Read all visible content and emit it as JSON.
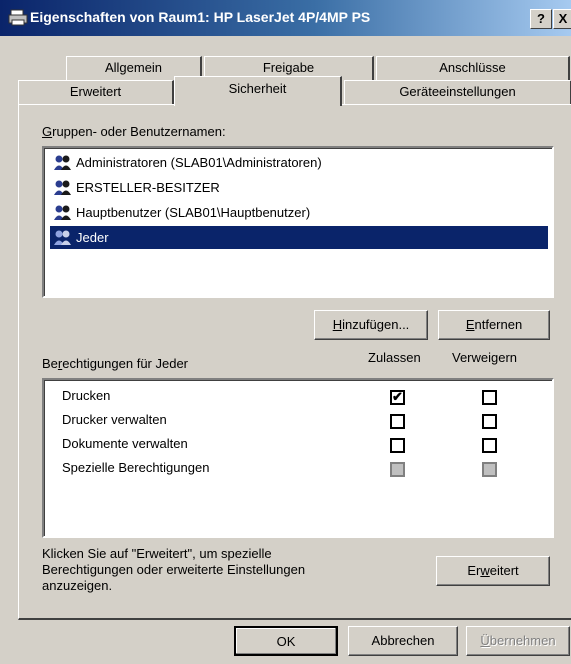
{
  "window": {
    "title": "Eigenschaften von Raum1: HP LaserJet 4P/4MP PS",
    "help_button": "?",
    "close_button": "X"
  },
  "tabs": {
    "row1": [
      "Allgemein",
      "Freigabe",
      "Anschlüsse"
    ],
    "row2": [
      "Erweitert",
      "Sicherheit",
      "Geräteeinstellungen"
    ],
    "active": "Sicherheit"
  },
  "groups": {
    "label_prefix": "G",
    "label_rest": "ruppen- oder Benutzernamen:",
    "items": [
      {
        "label": "Administratoren (SLAB01\\Administratoren)",
        "selected": false
      },
      {
        "label": "ERSTELLER-BESITZER",
        "selected": false
      },
      {
        "label": "Hauptbenutzer (SLAB01\\Hauptbenutzer)",
        "selected": false
      },
      {
        "label": "Jeder",
        "selected": true
      }
    ]
  },
  "buttons": {
    "add_prefix": "H",
    "add_rest": "inzufügen...",
    "remove_prefix": "E",
    "remove_rest": "ntfernen",
    "advanced_prefix": "Er",
    "advanced_mid": "w",
    "advanced_rest": "eitert",
    "ok": "OK",
    "cancel": "Abbrechen",
    "apply_prefix": "Ü",
    "apply_rest": "bernehmen"
  },
  "permissions": {
    "header_prefix": "Be",
    "header_mid": "r",
    "header_rest": "echtigungen für Jeder",
    "allow_header": "Zulassen",
    "deny_header": "Verweigern",
    "rows": [
      {
        "label": "Drucken",
        "allow": true,
        "deny": false,
        "disabled": false
      },
      {
        "label": "Drucker verwalten",
        "allow": false,
        "deny": false,
        "disabled": false
      },
      {
        "label": "Dokumente verwalten",
        "allow": false,
        "deny": false,
        "disabled": false
      },
      {
        "label": "Spezielle Berechtigungen",
        "allow": false,
        "deny": false,
        "disabled": true
      }
    ]
  },
  "hint": {
    "line1": "Klicken Sie auf \"Erweitert\", um spezielle",
    "line2": "Berechtigungen oder erweiterte Einstellungen",
    "line3": "anzuzeigen."
  },
  "icons": {
    "app": "printer-icon",
    "user": "user-group-icon",
    "check": "✔"
  }
}
